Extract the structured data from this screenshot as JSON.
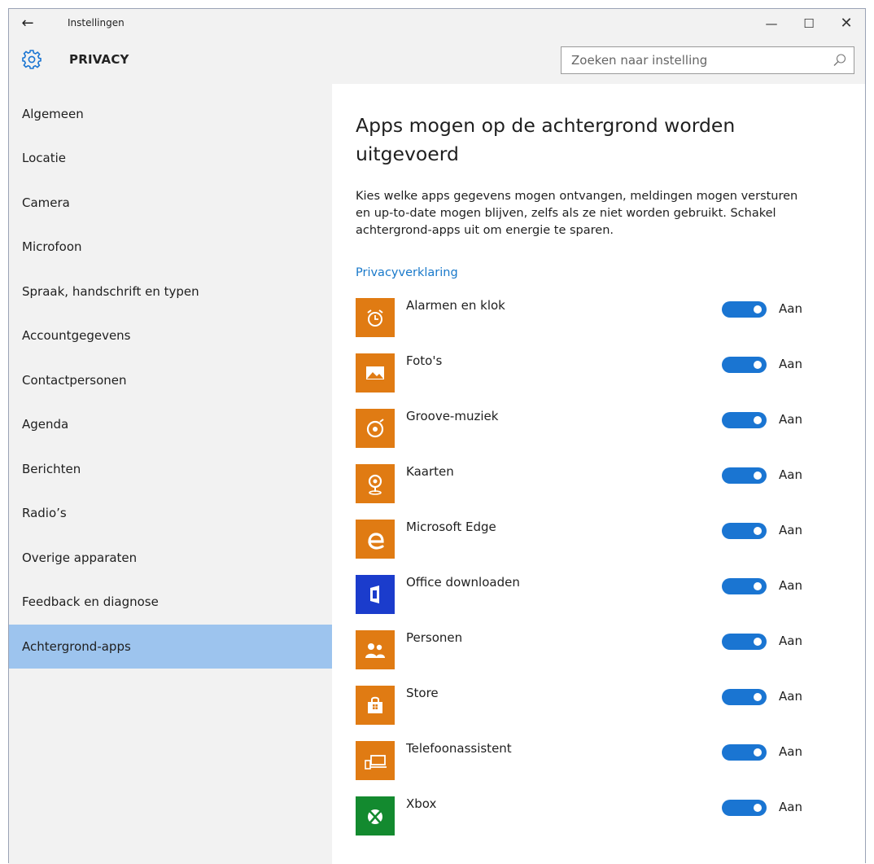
{
  "window": {
    "title": "Instellingen",
    "back_icon": "arrow-left-icon",
    "controls": {
      "minimize": "—",
      "maximize": "☐",
      "close": "✕"
    }
  },
  "header": {
    "icon": "gear-icon",
    "section": "PRIVACY",
    "search": {
      "value": "",
      "placeholder": "Zoeken naar instelling",
      "icon": "search-icon"
    }
  },
  "sidebar": {
    "selected": "Achtergrond-apps",
    "items": [
      {
        "label": "Algemeen"
      },
      {
        "label": "Locatie"
      },
      {
        "label": "Camera"
      },
      {
        "label": "Microfoon"
      },
      {
        "label": "Spraak, handschrift en typen"
      },
      {
        "label": "Accountgegevens"
      },
      {
        "label": "Contactpersonen"
      },
      {
        "label": "Agenda"
      },
      {
        "label": "Berichten"
      },
      {
        "label": "Radio’s"
      },
      {
        "label": "Overige apparaten"
      },
      {
        "label": "Feedback en diagnose"
      },
      {
        "label": "Achtergrond-apps"
      }
    ]
  },
  "main": {
    "title": "Apps mogen op de achtergrond worden uitgevoerd",
    "description": "Kies welke apps gegevens mogen ontvangen, meldingen mogen versturen en up-to-date mogen blijven, zelfs als ze niet worden gebruikt. Schakel achtergrond-apps uit om energie te sparen.",
    "privacy_link": "Privacyverklaring",
    "apps": [
      {
        "name": "Alarmen en klok",
        "icon": "alarm-clock-icon",
        "color": "#e07b13",
        "on": true,
        "state": "Aan"
      },
      {
        "name": "Foto's",
        "icon": "photos-icon",
        "color": "#e07b13",
        "on": true,
        "state": "Aan"
      },
      {
        "name": "Groove-muziek",
        "icon": "groove-music-icon",
        "color": "#e07b13",
        "on": true,
        "state": "Aan"
      },
      {
        "name": "Kaarten",
        "icon": "maps-icon",
        "color": "#e07b13",
        "on": true,
        "state": "Aan"
      },
      {
        "name": "Microsoft Edge",
        "icon": "edge-icon",
        "color": "#e07b13",
        "on": true,
        "state": "Aan"
      },
      {
        "name": "Office downloaden",
        "icon": "office-icon",
        "color": "#1b3ccc",
        "on": true,
        "state": "Aan"
      },
      {
        "name": "Personen",
        "icon": "people-icon",
        "color": "#e07b13",
        "on": true,
        "state": "Aan"
      },
      {
        "name": "Store",
        "icon": "store-icon",
        "color": "#e07b13",
        "on": true,
        "state": "Aan"
      },
      {
        "name": "Telefoonassistent",
        "icon": "phone-companion-icon",
        "color": "#e07b13",
        "on": true,
        "state": "Aan"
      },
      {
        "name": "Xbox",
        "icon": "xbox-icon",
        "color": "#138a2f",
        "on": true,
        "state": "Aan"
      }
    ]
  },
  "colors": {
    "accent": "#1a75d2",
    "link": "#1979ca",
    "selected_nav": "#9dc4ee",
    "chrome_bg": "#f2f2f2"
  }
}
